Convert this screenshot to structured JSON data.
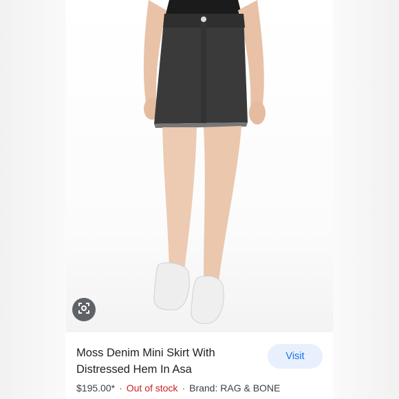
{
  "product": {
    "title": "Moss Denim Mini Skirt With Distressed Hem In Asa",
    "price": "$195.00*",
    "separator": "·",
    "stock_status": "Out of stock",
    "brand": "Brand: RAG & BONE",
    "visit_label": "Visit",
    "image_icon": "lens-icon"
  },
  "colors": {
    "visit_bg": "#e8f0fe",
    "visit_text": "#1a73e8",
    "out_of_stock": "#c5221f"
  }
}
